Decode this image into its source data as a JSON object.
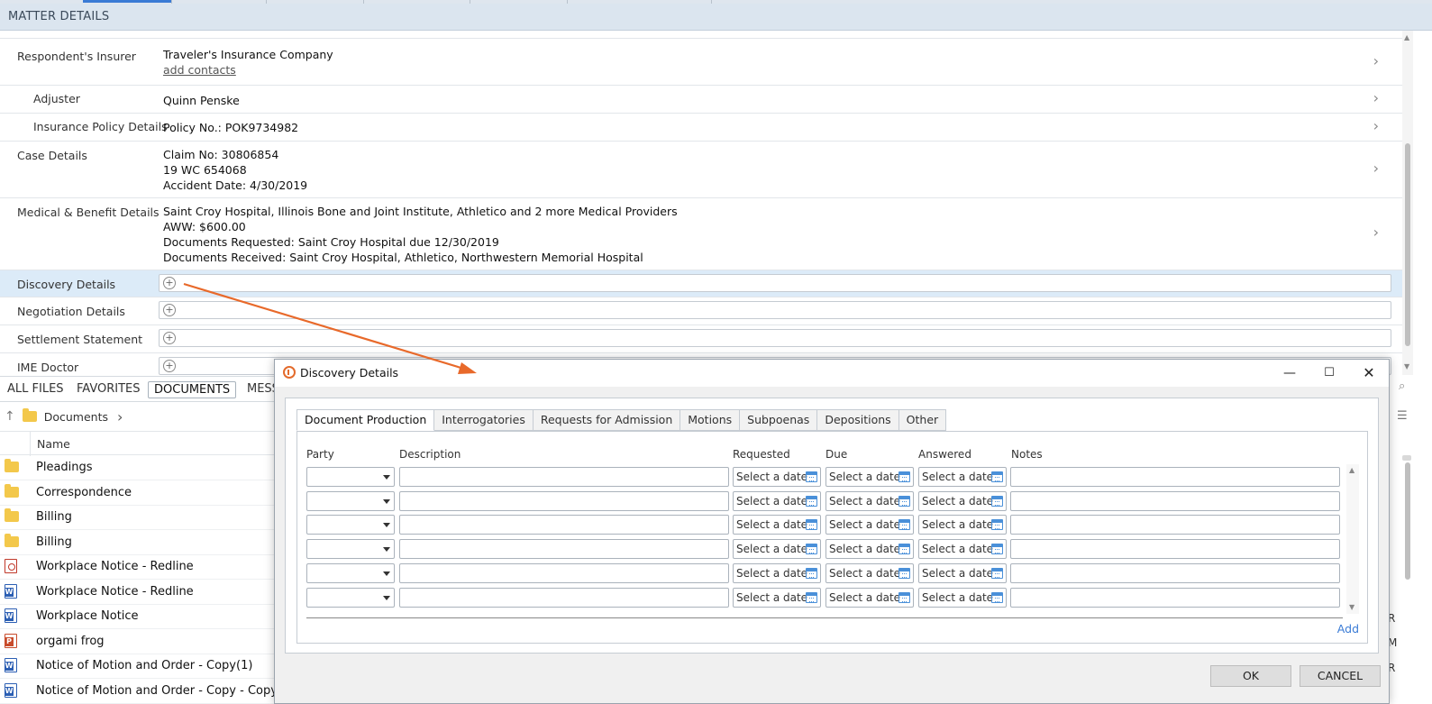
{
  "header": {
    "title": "MATTER DETAILS"
  },
  "details": {
    "rows": [
      {
        "label": "Respondent's Insurer",
        "lines": [
          "Traveler's Insurance Company"
        ],
        "link": "add contacts"
      },
      {
        "label": "Adjuster",
        "lines": [
          "Quinn Penske"
        ]
      },
      {
        "label": "Insurance Policy Details",
        "lines": [
          "Policy No.: POK9734982"
        ]
      },
      {
        "label": "Case Details",
        "lines": [
          "Claim No: 30806854",
          "19 WC 654068",
          "Accident Date: 4/30/2019"
        ]
      },
      {
        "label": "Medical & Benefit Details",
        "lines": [
          "Saint Croy Hospital, Illinois Bone and Joint Institute, Athletico and 2 more Medical Providers",
          "AWW: $600.00",
          "Documents Requested: Saint Croy Hospital due 12/30/2019",
          "Documents Received: Saint Croy Hospital, Athletico, Northwestern Memorial Hospital"
        ]
      },
      {
        "label": "Discovery Details"
      },
      {
        "label": "Negotiation Details"
      },
      {
        "label": "Settlement Statement"
      },
      {
        "label": "IME Doctor"
      }
    ]
  },
  "files": {
    "tabs": [
      "ALL FILES",
      "FAVORITES",
      "DOCUMENTS",
      "MESS"
    ],
    "active_tab": "DOCUMENTS",
    "breadcrumb": "Documents",
    "column_name": "Name",
    "items": [
      {
        "name": "Pleadings",
        "icon": "folder-icon"
      },
      {
        "name": "Correspondence",
        "icon": "folder-icon"
      },
      {
        "name": "Billing",
        "icon": "folder-icon"
      },
      {
        "name": "Billing",
        "icon": "folder-icon"
      },
      {
        "name": "Workplace Notice - Redline",
        "icon": "pdf-file-icon"
      },
      {
        "name": "Workplace Notice - Redline",
        "icon": "word-file-icon"
      },
      {
        "name": "Workplace Notice",
        "icon": "word-file-icon"
      },
      {
        "name": "orgami frog",
        "icon": "powerpoint-file-icon"
      },
      {
        "name": "Notice of Motion and Order - Copy(1)",
        "icon": "word-file-icon"
      },
      {
        "name": "Notice of Motion and Order - Copy - Copy",
        "icon": "word-file-icon"
      }
    ],
    "right_edge_letters": [
      "R",
      "M",
      "R"
    ]
  },
  "dialog": {
    "title": "Discovery Details",
    "tabs": [
      "Document Production",
      "Interrogatories",
      "Requests for Admission",
      "Motions",
      "Subpoenas",
      "Depositions",
      "Other"
    ],
    "active_tab": "Document Production",
    "columns": {
      "party": "Party",
      "description": "Description",
      "requested": "Requested",
      "due": "Due",
      "answered": "Answered",
      "notes": "Notes"
    },
    "date_placeholder": "Select a date",
    "row_count": 6,
    "add_label": "Add",
    "ok_label": "OK",
    "cancel_label": "CANCEL"
  },
  "colors": {
    "accent": "#3a7bd5",
    "header_bg": "#dbe5ef",
    "highlight": "#dcebf8",
    "arrow": "#e8692a"
  }
}
